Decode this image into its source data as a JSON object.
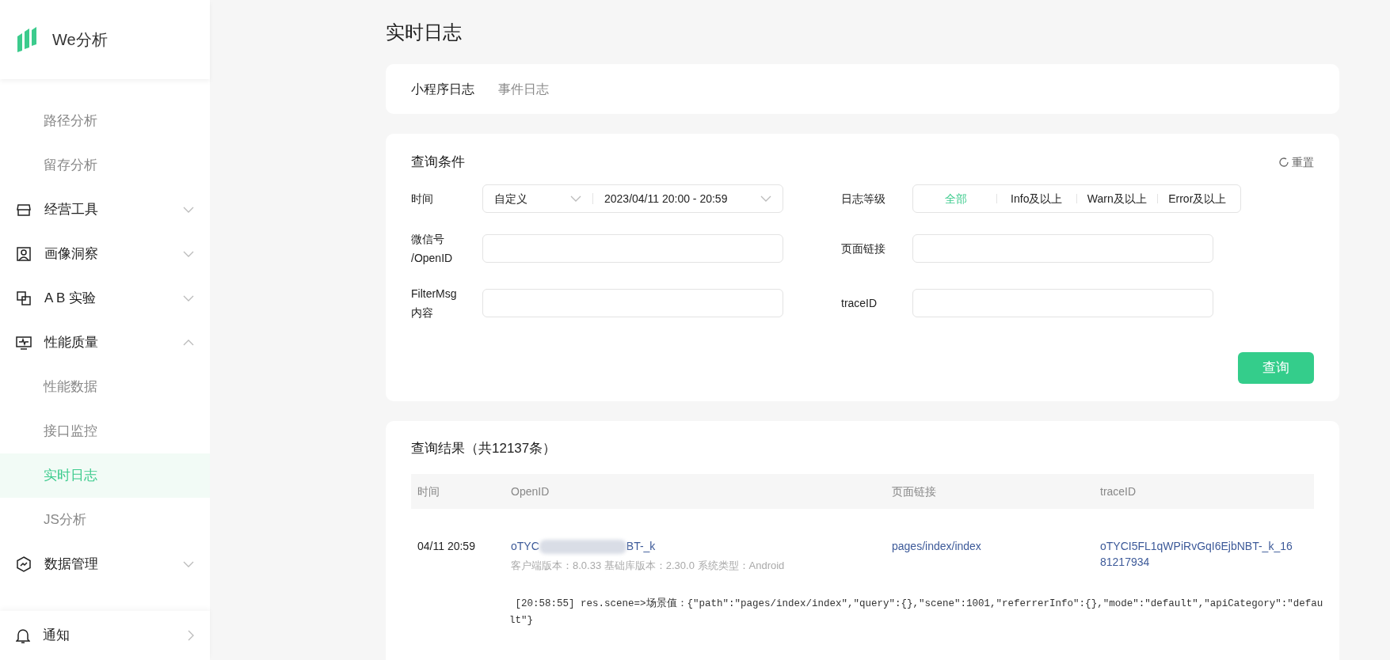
{
  "app": {
    "name": "We分析"
  },
  "sidebar": {
    "items": [
      {
        "label": "路径分析",
        "kind": "sub",
        "selected": false
      },
      {
        "label": "留存分析",
        "kind": "sub",
        "selected": false
      },
      {
        "label": "经营工具",
        "kind": "group",
        "expanded": false
      },
      {
        "label": "画像洞察",
        "kind": "group",
        "expanded": false
      },
      {
        "label": "A B 实验",
        "kind": "group",
        "expanded": false
      },
      {
        "label": "性能质量",
        "kind": "group",
        "expanded": true
      },
      {
        "label": "性能数据",
        "kind": "sub",
        "selected": false
      },
      {
        "label": "接口监控",
        "kind": "sub",
        "selected": false
      },
      {
        "label": "实时日志",
        "kind": "sub",
        "selected": true
      },
      {
        "label": "JS分析",
        "kind": "sub",
        "selected": false
      },
      {
        "label": "数据管理",
        "kind": "group",
        "expanded": false
      }
    ],
    "footer": {
      "label": "通知"
    }
  },
  "page_title": "实时日志",
  "tabs": [
    {
      "label": "小程序日志",
      "selected": true
    },
    {
      "label": "事件日志",
      "selected": false
    }
  ],
  "query": {
    "title": "查询条件",
    "reset": "重置",
    "time": {
      "label": "时间",
      "preset": "自定义",
      "range": "2023/04/11 20:00 - 20:59"
    },
    "level": {
      "label": "日志等级",
      "options": [
        {
          "label": "全部",
          "selected": true
        },
        {
          "label": "Info及以上",
          "selected": false
        },
        {
          "label": "Warn及以上",
          "selected": false
        },
        {
          "label": "Error及以上",
          "selected": false
        }
      ]
    },
    "fields": [
      {
        "label": "微信号\n/OpenID"
      },
      {
        "label": "页面链接"
      },
      {
        "label": "FilterMsg\n内容"
      },
      {
        "label": "traceID"
      }
    ],
    "submit": "查询"
  },
  "results": {
    "title": "查询结果（共12137条）",
    "columns": [
      "时间",
      "OpenID",
      "页面链接",
      "traceID"
    ],
    "rows": [
      {
        "time": "04/11 20:59",
        "openid_start": "oTYC",
        "openid_end": "BT-_k",
        "meta": "客户端版本：8.0.33 基础库版本：2.30.0 系统类型：Android",
        "page": "pages/index/index",
        "trace_id": "oTYCI5FL1qWPiRvGqI6EjbNBT-_k_1681217934",
        "logs": [
          " [20:58:55] res.scene=>场景值：{\"path\":\"pages/index/index\",\"query\":{},\"scene\":1001,\"referrerInfo\":{},\"mode\":\"default\",\"apiCategory\":\"default\"}"
        ]
      }
    ]
  }
}
